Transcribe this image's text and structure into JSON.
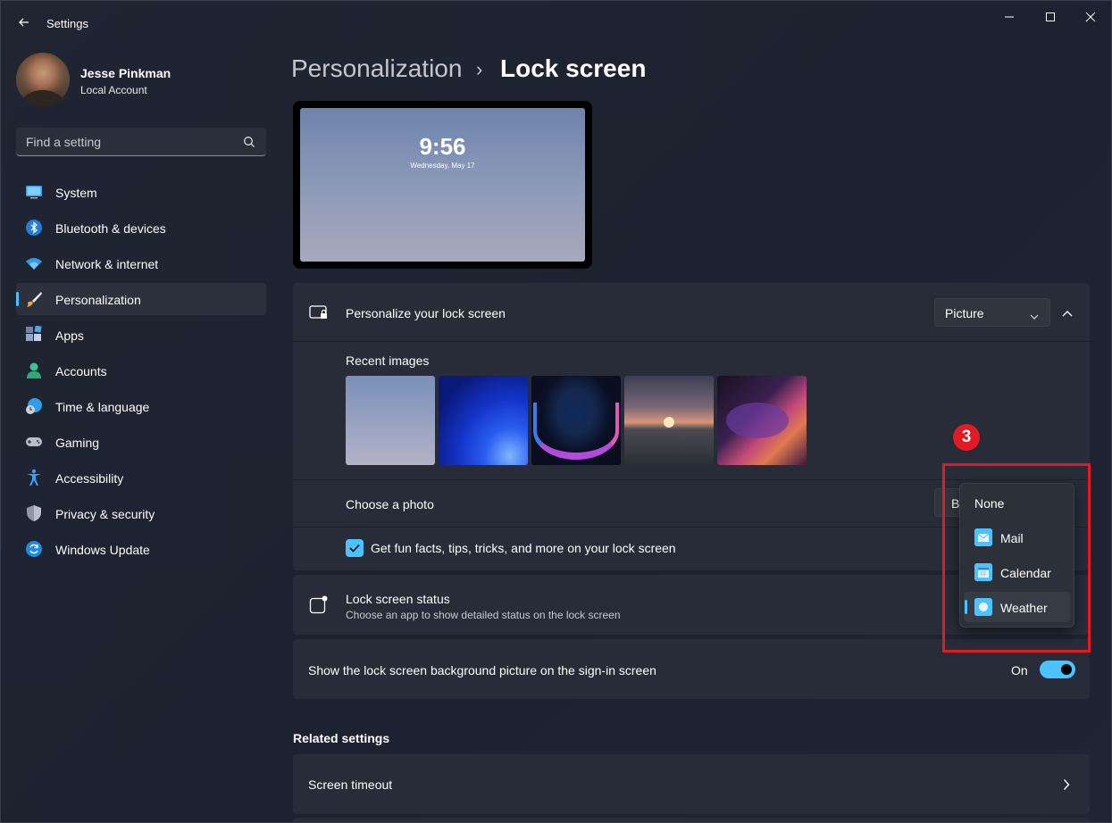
{
  "window": {
    "title": "Settings"
  },
  "profile": {
    "name": "Jesse Pinkman",
    "account_type": "Local Account"
  },
  "search": {
    "placeholder": "Find a setting"
  },
  "sidebar": {
    "items": [
      {
        "label": "System",
        "icon": "system-icon",
        "active": false
      },
      {
        "label": "Bluetooth & devices",
        "icon": "bluetooth-icon",
        "active": false
      },
      {
        "label": "Network & internet",
        "icon": "wifi-icon",
        "active": false
      },
      {
        "label": "Personalization",
        "icon": "brush-icon",
        "active": true
      },
      {
        "label": "Apps",
        "icon": "apps-icon",
        "active": false
      },
      {
        "label": "Accounts",
        "icon": "person-icon",
        "active": false
      },
      {
        "label": "Time & language",
        "icon": "globe-clock-icon",
        "active": false
      },
      {
        "label": "Gaming",
        "icon": "gamepad-icon",
        "active": false
      },
      {
        "label": "Accessibility",
        "icon": "accessibility-icon",
        "active": false
      },
      {
        "label": "Privacy & security",
        "icon": "shield-icon",
        "active": false
      },
      {
        "label": "Windows Update",
        "icon": "update-icon",
        "active": false
      }
    ]
  },
  "breadcrumb": {
    "parent": "Personalization",
    "separator": "›",
    "current": "Lock screen"
  },
  "preview": {
    "time": "9:56",
    "date": "Wednesday, May 17"
  },
  "personalize": {
    "label": "Personalize your lock screen",
    "dropdown_value": "Picture",
    "recent_images_label": "Recent images",
    "choose_photo_label": "Choose a photo",
    "browse_label_visible": "B",
    "fun_facts_label": "Get fun facts, tips, tricks, and more on your lock screen",
    "fun_facts_checked": true
  },
  "status": {
    "label": "Lock screen status",
    "description": "Choose an app to show detailed status on the lock screen"
  },
  "signin": {
    "label": "Show the lock screen background picture on the sign-in screen",
    "state_label": "On",
    "on": true
  },
  "related": {
    "heading": "Related settings",
    "screen_timeout": "Screen timeout"
  },
  "flyout": {
    "options": [
      {
        "label": "None",
        "icon": null,
        "selected": false
      },
      {
        "label": "Mail",
        "icon": "mail-icon",
        "selected": false
      },
      {
        "label": "Calendar",
        "icon": "calendar-icon",
        "selected": false
      },
      {
        "label": "Weather",
        "icon": "weather-icon",
        "selected": true
      }
    ]
  },
  "annotation": {
    "step_number": "3"
  },
  "colors": {
    "accent": "#4cc2ff",
    "annotation_red": "#e01b24",
    "card_bg": "#272c38",
    "window_bg": "#1e2331"
  }
}
